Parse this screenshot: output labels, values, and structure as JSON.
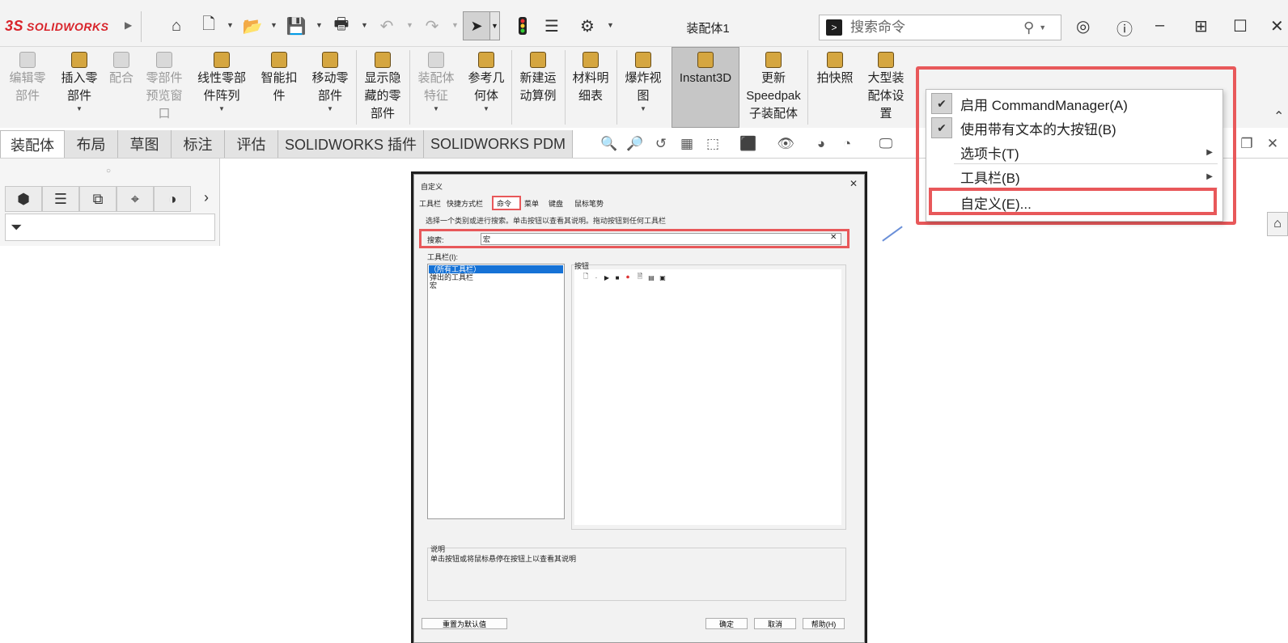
{
  "app": {
    "logo_prefix": "3S",
    "logo_name": "SOLIDWORKS",
    "doc_title": "装配体1"
  },
  "search": {
    "placeholder": "搜索命令"
  },
  "ribbon": {
    "buttons": [
      {
        "l1": "编辑零",
        "l2": "部件",
        "l3": ""
      },
      {
        "l1": "插入零",
        "l2": "部件",
        "l3": ""
      },
      {
        "l1": "配合",
        "l2": "",
        "l3": ""
      },
      {
        "l1": "零部件",
        "l2": "预览窗",
        "l3": "口"
      },
      {
        "l1": "线性零部",
        "l2": "件阵列",
        "l3": ""
      },
      {
        "l1": "智能扣",
        "l2": "件",
        "l3": ""
      },
      {
        "l1": "移动零",
        "l2": "部件",
        "l3": ""
      },
      {
        "l1": "显示隐",
        "l2": "藏的零",
        "l3": "部件"
      },
      {
        "l1": "装配体",
        "l2": "特征",
        "l3": ""
      },
      {
        "l1": "参考几",
        "l2": "何体",
        "l3": ""
      },
      {
        "l1": "新建运",
        "l2": "动算例",
        "l3": ""
      },
      {
        "l1": "材料明",
        "l2": "细表",
        "l3": ""
      },
      {
        "l1": "爆炸视",
        "l2": "图",
        "l3": ""
      },
      {
        "l1": "Instant3D",
        "l2": "",
        "l3": ""
      },
      {
        "l1": "更新",
        "l2": "Speedpak",
        "l3": "子装配体"
      },
      {
        "l1": "拍快照",
        "l2": "",
        "l3": ""
      },
      {
        "l1": "大型装",
        "l2": "配体设",
        "l3": "置"
      }
    ]
  },
  "tabs": [
    "装配体",
    "布局",
    "草图",
    "标注",
    "评估",
    "SOLIDWORKS 插件",
    "SOLIDWORKS PDM"
  ],
  "context_menu": {
    "items": [
      "启用 CommandManager(A)",
      "使用带有文本的大按钮(B)",
      "选项卡(T)",
      "工具栏(B)",
      "自定义(E)..."
    ]
  },
  "dialog": {
    "title": "自定义",
    "tabs": [
      "工具栏",
      "快捷方式栏",
      "命令",
      "菜单",
      "键盘",
      "鼠标笔势"
    ],
    "instruction": "选择一个类别或进行搜索。单击按钮以查看其说明。拖动按钮到任何工具栏",
    "search_label": "搜索:",
    "search_value": "宏",
    "toolbars_label": "工具栏(I):",
    "toolbar_list": [
      "（所有工具栏）",
      "弹出的工具栏",
      "宏"
    ],
    "buttons_label": "按钮",
    "description_label": "说明",
    "description_text": "单击按钮或将鼠标悬停在按钮上以查看其说明",
    "reset_label": "重置为默认值",
    "ok_label": "确定",
    "cancel_label": "取消",
    "help_label": "帮助(H)"
  },
  "colors": {
    "highlight_red": "#e8585a",
    "brand_red": "#d8232a",
    "selection_blue": "#1672d6"
  }
}
